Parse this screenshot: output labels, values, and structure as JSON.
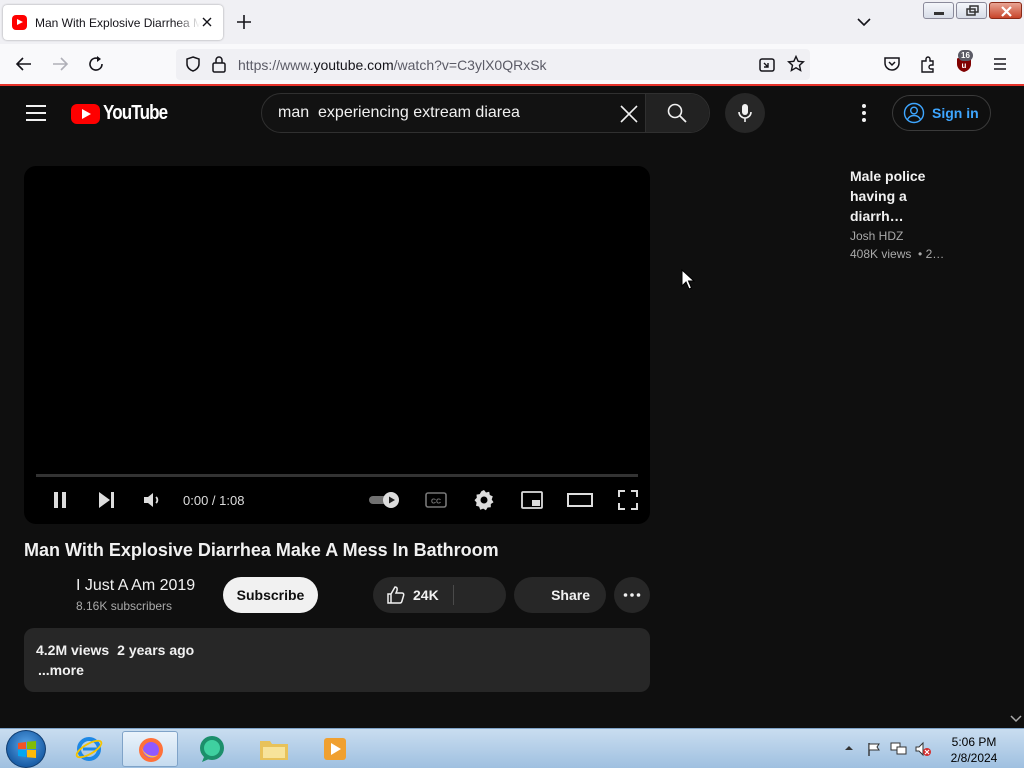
{
  "browser": {
    "tab_title": "Man With Explosive Diarrhea Make A Mess In Bathroom",
    "url_prefix": "https://www.",
    "url_host": "youtube.com",
    "url_path": "/watch?v=C3ylX0QRxSk",
    "extension_badge": "16"
  },
  "youtube": {
    "logo_text": "YouTube",
    "search_query": "man  experiencing extream diarea",
    "signin_label": "Sign in",
    "player": {
      "time": "0:00 / 1:08",
      "progress": 0
    },
    "video": {
      "title": "Man With Explosive Diarrhea Make A Mess In Bathroom",
      "channel": "I Just A Am 2019",
      "subscribers": "8.16K subscribers",
      "subscribe_label": "Subscribe",
      "likes": "24K",
      "share_label": "Share",
      "views": "4.2M views",
      "age": "2 years ago",
      "more_label": "...more"
    },
    "related": [
      {
        "title": "Male police having a diarrh…",
        "channel": "Josh HDZ",
        "views": "408K views",
        "age": "• 2…"
      }
    ]
  },
  "taskbar": {
    "time": "5:06 PM",
    "date": "2/8/2024"
  },
  "colors": {
    "youtube_red": "#ff0000",
    "link_blue": "#3ea6ff",
    "background": "#0f0f0f"
  }
}
